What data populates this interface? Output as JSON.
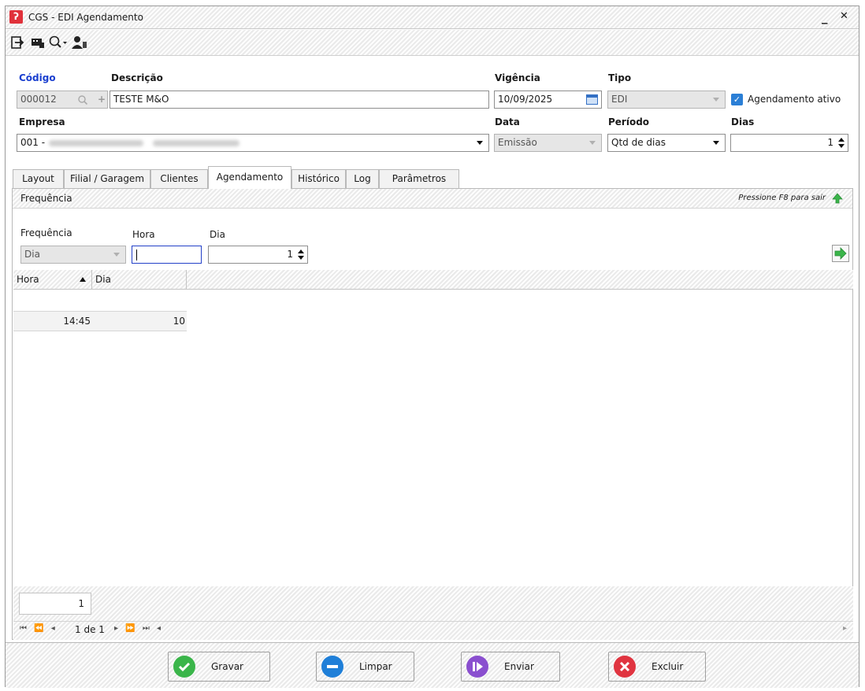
{
  "window": {
    "title": "CGS - EDI Agendamento",
    "logo_glyph": "ʔ",
    "minimize": "_",
    "close": "✕"
  },
  "toolbar": {
    "icons": [
      "exit-icon",
      "terminal-icon",
      "search-dropdown-icon",
      "user-icon"
    ]
  },
  "form": {
    "codigo_label": "Código",
    "codigo_value": "000012",
    "descricao_label": "Descrição",
    "descricao_value": "TESTE M&O",
    "vigencia_label": "Vigência",
    "vigencia_value": "10/09/2025",
    "tipo_label": "Tipo",
    "tipo_value": "EDI",
    "agendamento_ativo_label": "Agendamento ativo",
    "agendamento_ativo_checked": true,
    "empresa_label": "Empresa",
    "empresa_value": "001 -",
    "data_label": "Data",
    "data_value": "Emissão",
    "periodo_label": "Período",
    "periodo_value": "Qtd de dias",
    "dias_label": "Dias",
    "dias_value": "1"
  },
  "tabs": [
    {
      "label": "Layout",
      "active": false
    },
    {
      "label": "Filial / Garagem",
      "active": false
    },
    {
      "label": "Clientes",
      "active": false
    },
    {
      "label": "Agendamento",
      "active": true
    },
    {
      "label": "Histórico",
      "active": false
    },
    {
      "label": "Log",
      "active": false
    },
    {
      "label": "Parâmetros",
      "active": false
    }
  ],
  "panel": {
    "header_title": "Frequência",
    "hint": "Pressione F8 para sair",
    "frequencia_label": "Frequência",
    "frequencia_value": "Dia",
    "hora_label": "Hora",
    "hora_value": "",
    "dia_label": "Dia",
    "dia_value": "1",
    "grid": {
      "columns": [
        "Hora",
        "Dia"
      ],
      "sort_column": "Hora",
      "sort_direction": "asc",
      "rows": [
        {
          "hora": "14:45",
          "dia": "10"
        }
      ],
      "footer_count": "1",
      "pager_text": "1 de 1"
    }
  },
  "buttons": {
    "gravar": "Gravar",
    "limpar": "Limpar",
    "enviar": "Enviar",
    "excluir": "Excluir"
  },
  "colors": {
    "label_blue": "#1a3fcf",
    "logo_red": "#e0313a",
    "green": "#3ab54a",
    "blue": "#1f7fd8",
    "purple": "#8a4fcf",
    "red": "#e03440",
    "checkbox": "#2b7fd6"
  }
}
